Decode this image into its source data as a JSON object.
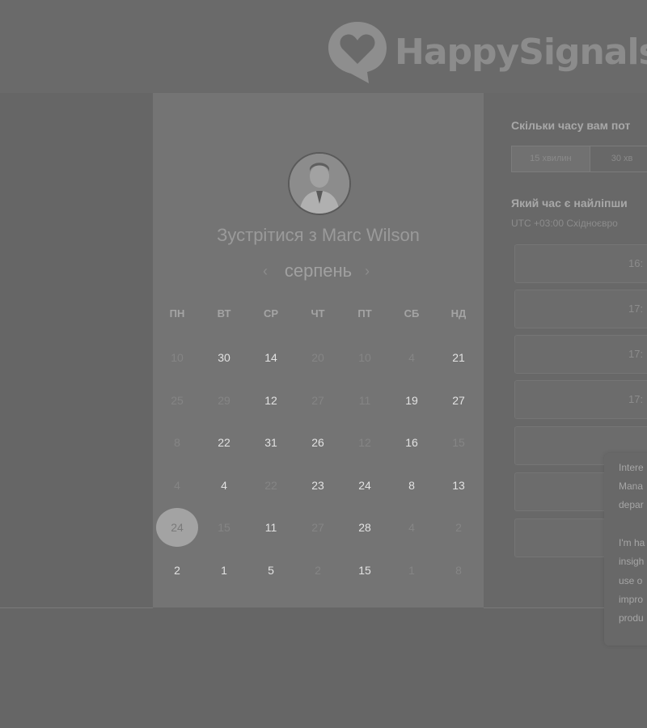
{
  "brand": {
    "name": "HappySignals"
  },
  "booking": {
    "title": "Зустрітися з Marc Wilson",
    "month": "серпень",
    "weekdays": [
      "ПН",
      "ВТ",
      "СР",
      "ЧТ",
      "ПТ",
      "СБ",
      "НД"
    ],
    "weeks": [
      [
        {
          "d": "10",
          "on": false
        },
        {
          "d": "30",
          "on": true
        },
        {
          "d": "14",
          "on": true
        },
        {
          "d": "20",
          "on": false
        },
        {
          "d": "10",
          "on": false
        },
        {
          "d": "4",
          "on": false
        },
        {
          "d": "21",
          "on": true
        }
      ],
      [
        {
          "d": "25",
          "on": false
        },
        {
          "d": "29",
          "on": false
        },
        {
          "d": "12",
          "on": true
        },
        {
          "d": "27",
          "on": false
        },
        {
          "d": "11",
          "on": false
        },
        {
          "d": "19",
          "on": true
        },
        {
          "d": "27",
          "on": true
        }
      ],
      [
        {
          "d": "8",
          "on": false
        },
        {
          "d": "22",
          "on": true
        },
        {
          "d": "31",
          "on": true
        },
        {
          "d": "26",
          "on": true
        },
        {
          "d": "12",
          "on": false
        },
        {
          "d": "16",
          "on": true
        },
        {
          "d": "15",
          "on": false
        }
      ],
      [
        {
          "d": "4",
          "on": false
        },
        {
          "d": "4",
          "on": true
        },
        {
          "d": "22",
          "on": false
        },
        {
          "d": "23",
          "on": true
        },
        {
          "d": "24",
          "on": true
        },
        {
          "d": "8",
          "on": true
        },
        {
          "d": "13",
          "on": true
        }
      ],
      [
        {
          "d": "24",
          "on": false,
          "selected": true
        },
        {
          "d": "15",
          "on": false
        },
        {
          "d": "11",
          "on": true
        },
        {
          "d": "27",
          "on": false
        },
        {
          "d": "28",
          "on": true
        },
        {
          "d": "4",
          "on": false
        },
        {
          "d": "2",
          "on": false
        }
      ],
      [
        {
          "d": "2",
          "on": true
        },
        {
          "d": "1",
          "on": true
        },
        {
          "d": "5",
          "on": true
        },
        {
          "d": "2",
          "on": false
        },
        {
          "d": "15",
          "on": true
        },
        {
          "d": "1",
          "on": false
        },
        {
          "d": "8",
          "on": false
        }
      ]
    ]
  },
  "schedule": {
    "duration_question": "Скільки часу вам пот",
    "durations": [
      "15 хвилин",
      "30 хв"
    ],
    "time_question": "Який час є найліпши",
    "timezone": "UTC +03:00 Східноєвро",
    "slots": [
      "16:",
      "17:",
      "17:",
      "17:"
    ]
  },
  "chat": {
    "lines": [
      "Intere",
      "Mana",
      "depar",
      "",
      "I'm ha",
      "insigh",
      "use o",
      "impro",
      "produ"
    ]
  }
}
